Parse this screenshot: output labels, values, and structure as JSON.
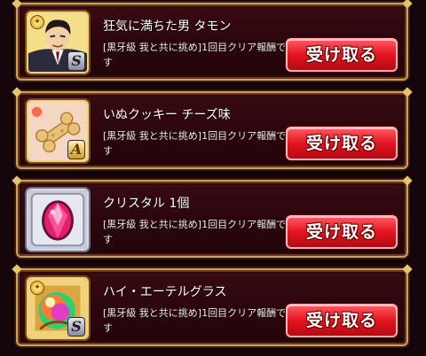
{
  "rewards": [
    {
      "title": "狂気に満ちた男 タモン",
      "description": "[黒牙級 我と共に挑め]1回目クリア報酬です",
      "rank": "S",
      "icon": "character-portrait-icon",
      "claim_label": "受け取る"
    },
    {
      "title": "いぬクッキー チーズ味",
      "description": "[黒牙級 我と共に挑め]1回目クリア報酬です",
      "rank": "A",
      "icon": "dog-bone-cookie-icon",
      "claim_label": "受け取る"
    },
    {
      "title": "クリスタル 1個",
      "description": "[黒牙級 我と共に挑め]1回目クリア報酬です",
      "rank": "",
      "icon": "crystal-gem-icon",
      "claim_label": "受け取る"
    },
    {
      "title": "ハイ・エーテルグラス",
      "description": "[黒牙級 我と共に挑め]1回目クリア報酬です",
      "rank": "S",
      "icon": "ether-glass-icon",
      "claim_label": "受け取る"
    }
  ],
  "colors": {
    "panel": "#2a060c",
    "frame": "#caa25a",
    "button": "#e3141f"
  }
}
